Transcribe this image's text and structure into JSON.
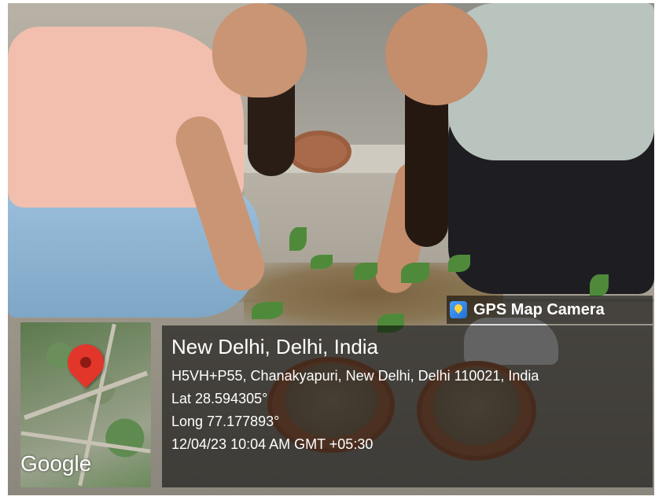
{
  "overlay": {
    "brand": "GPS Map Camera",
    "map_label": "Google",
    "place_title": "New Delhi, Delhi, India",
    "address": "H5VH+P55, Chanakyapuri, New Delhi, Delhi 110021, India",
    "lat": "Lat 28.594305°",
    "long": "Long 77.177893°",
    "datetime": "12/04/23 10:04 AM GMT +05:30"
  },
  "icons": {
    "brand_icon": "map-camera-icon",
    "pin_icon": "map-pin-icon"
  },
  "colors": {
    "pin": "#e3362b",
    "overlay_bg": "rgba(0,0,0,0.55)",
    "text": "#ffffff"
  }
}
